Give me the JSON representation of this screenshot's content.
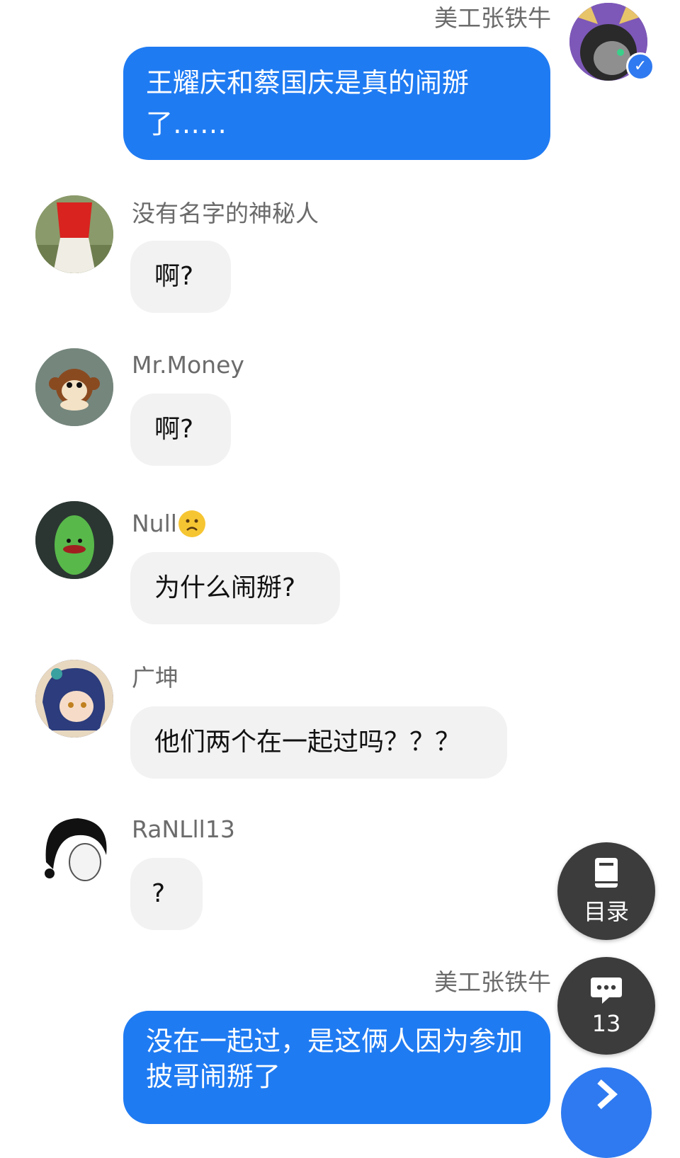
{
  "messages": [
    {
      "author": "美工张铁牛",
      "text": "王耀庆和蔡国庆是真的闹掰了……",
      "side": "right"
    },
    {
      "author": "没有名字的神秘人",
      "text": "啊?",
      "side": "left"
    },
    {
      "author": "Mr.Money",
      "text": "啊?",
      "side": "left"
    },
    {
      "author": "Null",
      "text": "为什么闹掰?",
      "side": "left"
    },
    {
      "author": "广坤",
      "text": "他们两个在一起过吗？？？",
      "side": "left"
    },
    {
      "author": "RaNLll13",
      "text": "?",
      "side": "left"
    },
    {
      "author": "美工张铁牛",
      "text": "没在一起过，是这俩人因为参加披哥闹掰了",
      "side": "right"
    }
  ],
  "toc_button": {
    "label": "目录",
    "icon": "book-icon"
  },
  "comments_button": {
    "count": "13",
    "icon": "chat-bubble-icon"
  },
  "colors": {
    "outgoing_bubble": "#1f7bf2",
    "incoming_bubble": "#f2f2f2",
    "fab": "#3c3c3c"
  }
}
